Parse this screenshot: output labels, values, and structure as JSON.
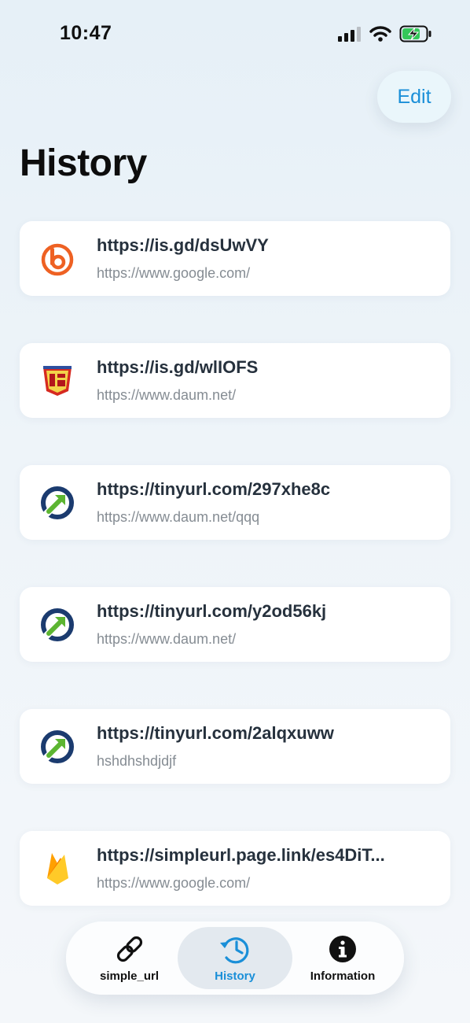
{
  "status_bar": {
    "time": "10:47"
  },
  "header": {
    "edit_label": "Edit",
    "title": "History"
  },
  "history": {
    "items": [
      {
        "short_url": "https://is.gd/dsUwVY",
        "original_url": "https://www.google.com/",
        "icon": "bitly-logo-icon"
      },
      {
        "short_url": "https://is.gd/wlIOFS",
        "original_url": "https://www.daum.net/",
        "icon": "isgd-logo-icon"
      },
      {
        "short_url": "https://tinyurl.com/297xhe8c",
        "original_url": "https://www.daum.net/qqq",
        "icon": "tinyurl-logo-icon"
      },
      {
        "short_url": "https://tinyurl.com/y2od56kj",
        "original_url": "https://www.daum.net/",
        "icon": "tinyurl-logo-icon"
      },
      {
        "short_url": "https://tinyurl.com/2alqxuww",
        "original_url": "hshdhshdjdjf",
        "icon": "tinyurl-logo-icon"
      },
      {
        "short_url": "https://simpleurl.page.link/es4DiT...",
        "original_url": "https://www.google.com/",
        "icon": "firebase-logo-icon"
      }
    ]
  },
  "tab_bar": {
    "tabs": [
      {
        "label": "simple_url",
        "icon": "link-icon",
        "selected": false
      },
      {
        "label": "History",
        "icon": "clock-history-icon",
        "selected": true
      },
      {
        "label": "Information",
        "icon": "info-icon",
        "selected": false
      }
    ]
  },
  "colors": {
    "accent": "#1a8fd8",
    "background_top": "#e6f0f7",
    "card": "#ffffff",
    "battery_green": "#34c759",
    "bitly_orange": "#ee6123",
    "tinyurl_blue": "#1b3b6f",
    "tinyurl_green": "#5cb531",
    "firebase_yellow": "#ffca28"
  }
}
